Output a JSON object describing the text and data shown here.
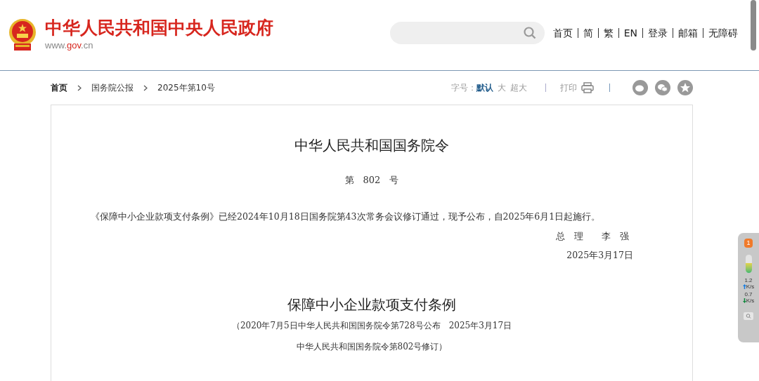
{
  "header": {
    "site_title": "中华人民共和国中央人民政府",
    "site_url_prefix": "www.",
    "site_url_domain": "gov",
    "site_url_suffix": ".cn",
    "nav_links": [
      "首页",
      "简",
      "繁",
      "EN",
      "登录",
      "邮箱",
      "无障碍"
    ]
  },
  "breadcrumb": [
    "首页",
    "国务院公报",
    "2025年第10号"
  ],
  "toolbar": {
    "font_size_label": "字号：",
    "font_sizes": [
      {
        "label": "默认",
        "selected": true
      },
      {
        "label": "大",
        "selected": false
      },
      {
        "label": "超大",
        "selected": false
      }
    ],
    "print_label": "打印"
  },
  "decree": {
    "title": "中华人民共和国国务院令",
    "number": "第　802　号",
    "body": "《保障中小企业款项支付条例》已经2024年10月18日国务院第43次常务会议修订通过，现予公布，自2025年6月1日起施行。",
    "signatory": "总　理　　李　强",
    "date": "2025年3月17日"
  },
  "regulation": {
    "title": "保障中小企业款项支付条例",
    "note_lines": [
      "（2020年7月5日中华人民共和国国务院令第728号公布　2025年3月17日",
      "中华人民共和国国务院令第802号修订）"
    ]
  },
  "side_widget": {
    "badge": "1",
    "meter": {
      "level": 0.55
    },
    "upload_value": "1.2",
    "upload_unit": "K/s",
    "download_value": "0.7",
    "download_unit": "K/s"
  }
}
